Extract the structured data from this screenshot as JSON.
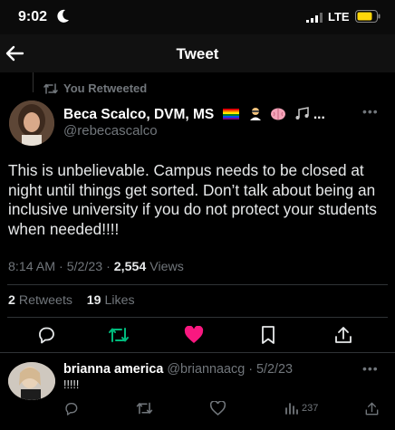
{
  "status_bar": {
    "time": "9:02",
    "network": "LTE"
  },
  "nav": {
    "title": "Tweet"
  },
  "retweet_context": {
    "label": "You Retweeted"
  },
  "tweet": {
    "display_name": "Beca Scalco, DVM, MS",
    "name_suffix": "...",
    "handle": "@rebecascalco",
    "text": "This is unbelievable. Campus needs to be closed at night until things get sorted. Don’t talk about being an inclusive university if you do not protect your students when needed!!!!",
    "time": "8:14 AM",
    "date": "5/2/23",
    "views_count": "2,554",
    "views_label": "Views",
    "retweets_count": "2",
    "retweets_label": "Retweets",
    "likes_count": "19",
    "likes_label": "Likes"
  },
  "reply": {
    "display_name": "brianna america",
    "handle": "@briannaacg",
    "date": "5/2/23",
    "text": "!!!!!",
    "views_count": "237"
  },
  "colors": {
    "background": "#000000",
    "text": "#e7e9ea",
    "secondary": "#71767b",
    "retweet_active": "#00ba7c",
    "like_active": "#f91880",
    "divider": "#2f3336"
  },
  "icons": [
    "moon-icon",
    "signal-icon",
    "battery-icon",
    "back-arrow-icon",
    "retweet-icon",
    "reply-icon",
    "heart-icon",
    "bookmark-icon",
    "share-icon",
    "views-icon",
    "more-icon"
  ]
}
